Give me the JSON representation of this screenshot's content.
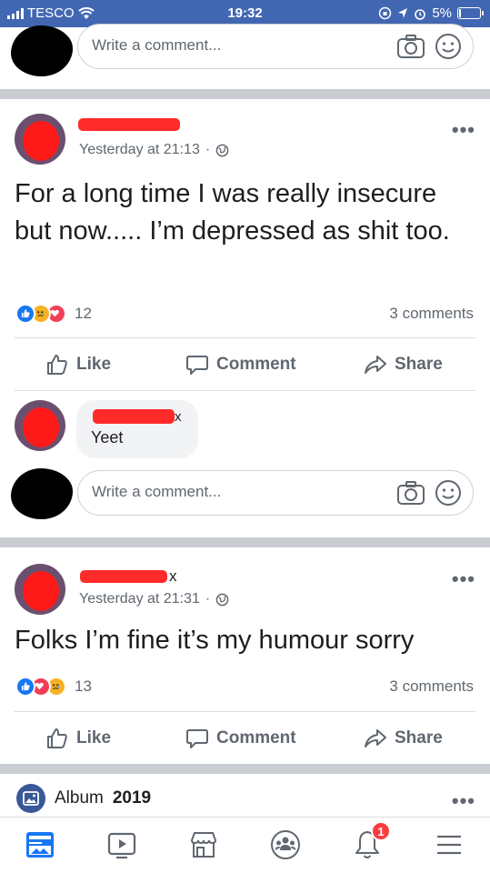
{
  "status_bar": {
    "carrier": "TESCO",
    "time": "19:32",
    "battery": "5%",
    "battery_level": 0.05
  },
  "composer": {
    "placeholder": "Write a comment..."
  },
  "posts": [
    {
      "timestamp": "Yesterday at 21:13",
      "text": "For a long time I was really insecure but now..... I’m depressed as shit too.",
      "reaction_count": "12",
      "comments_count": "3 comments",
      "reaction_icons": [
        "like",
        "sad",
        "love"
      ]
    },
    {
      "name_suffix": "x",
      "timestamp": "Yesterday at 21:31",
      "text": "Folks I’m fine it’s my humour sorry",
      "reaction_count": "13",
      "comments_count": "3 comments",
      "reaction_icons": [
        "like",
        "love",
        "sad"
      ]
    }
  ],
  "reply": {
    "name_suffix": "x",
    "text": "Yeet"
  },
  "actions": {
    "like": "Like",
    "comment": "Comment",
    "share": "Share"
  },
  "album": {
    "name": "Album",
    "year": "2019"
  },
  "tabbar": {
    "notification_badge": "1"
  },
  "colors": {
    "brand": "#4267b2",
    "like": "#1877f2",
    "love": "#f33e58",
    "sad": "#f7b125"
  },
  "icons": [
    "wifi-icon",
    "signal-icon",
    "battery-icon",
    "camera-icon",
    "smiley-icon",
    "globe-icon",
    "like-icon",
    "comment-icon",
    "share-icon",
    "news-feed-icon",
    "watch-icon",
    "marketplace-icon",
    "groups-icon",
    "notifications-icon",
    "menu-icon"
  ]
}
